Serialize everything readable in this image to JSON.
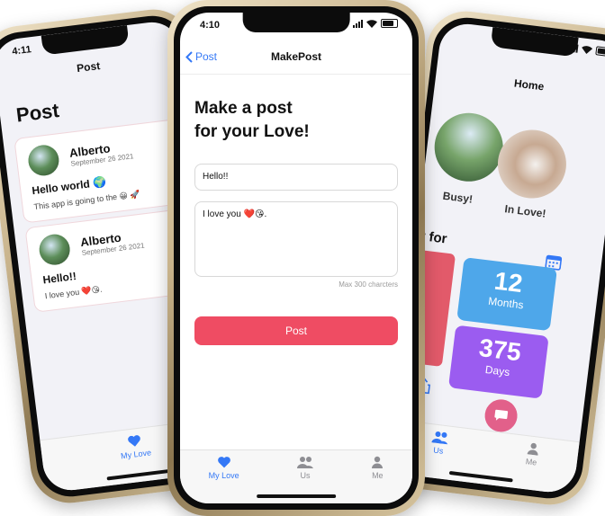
{
  "left_phone": {
    "status_time": "4:11",
    "nav_title": "Post",
    "large_title": "Post",
    "posts": [
      {
        "author": "Alberto",
        "date": "September 26 2021",
        "title": "Hello world 🌍",
        "body": "This app is going to the 😀 🚀"
      },
      {
        "author": "Alberto",
        "date": "September 26 2021",
        "title": "Hello!!",
        "body": "I love you ❤️😘."
      }
    ],
    "tabs": [
      {
        "label": "My Love",
        "icon": "heart-icon"
      }
    ]
  },
  "center_phone": {
    "status_time": "4:10",
    "back_label": "Post",
    "nav_title": "MakePost",
    "headline_line1": "Make a post",
    "headline_line2": "for your Love!",
    "title_field_value": "Hello!!",
    "body_field_value": "I love you ❤️😘.",
    "char_counter": "Max 300 charcters",
    "post_button": "Post",
    "tabs": [
      {
        "label": "My Love",
        "icon": "heart-icon"
      },
      {
        "label": "Us",
        "icon": "people-icon"
      },
      {
        "label": "Me",
        "icon": "person-icon"
      }
    ]
  },
  "right_phone": {
    "nav_title": "Home",
    "photo_labels": [
      "Busy!",
      "In Love!"
    ],
    "section_title": "er for",
    "months_value": "12",
    "months_label": "Months",
    "days_value": "375",
    "days_label": "Days",
    "tabs": [
      {
        "label": "Us",
        "icon": "people-icon"
      },
      {
        "label": "Me",
        "icon": "person-icon"
      }
    ]
  },
  "colors": {
    "accent_blue": "#3478f6",
    "post_button": "#ef4c63",
    "months_tile": "#4ea7ea",
    "days_tile": "#9b5cf0",
    "pink_box": "#e25a6a",
    "fab": "#e2608a"
  }
}
